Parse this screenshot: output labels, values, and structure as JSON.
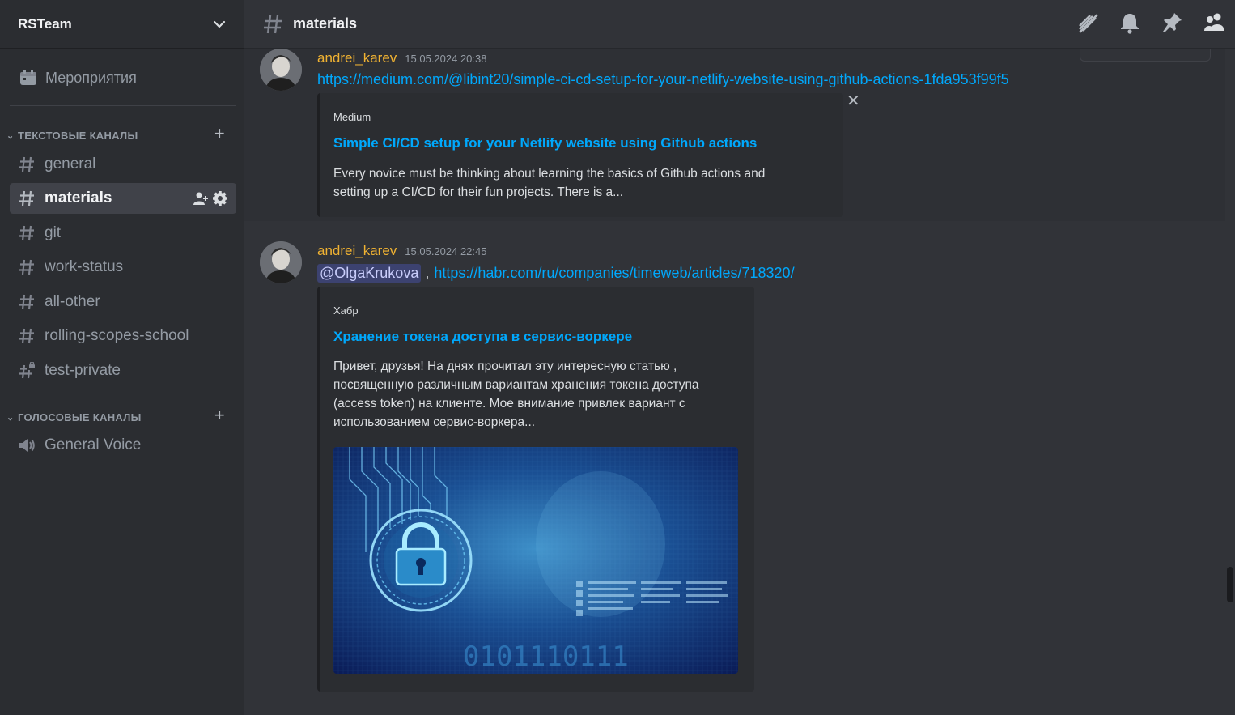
{
  "server": {
    "name": "RSTeam"
  },
  "sidebar": {
    "events_label": "Мероприятия",
    "text_category": "ТЕКСТОВЫЕ КАНАЛЫ",
    "voice_category": "ГОЛОСОВЫЕ КАНАЛЫ",
    "text_channels": [
      {
        "name": "general"
      },
      {
        "name": "materials",
        "active": true
      },
      {
        "name": "git"
      },
      {
        "name": "work-status"
      },
      {
        "name": "all-other"
      },
      {
        "name": "rolling-scopes-school"
      },
      {
        "name": "test-private"
      }
    ],
    "voice_channels": [
      {
        "name": "General Voice"
      }
    ]
  },
  "header": {
    "channel": "materials",
    "icons": [
      "threads-icon",
      "bell-icon",
      "pin-icon",
      "members-icon"
    ]
  },
  "messages": [
    {
      "author": "andrei_karev",
      "timestamp": "15.05.2024 20:38",
      "link": "https://medium.com/@libint20/simple-ci-cd-setup-for-your-netlify-website-using-github-actions-1fda953f99f5",
      "embed": {
        "provider": "Medium",
        "title": "Simple CI/CD setup for your Netlify website using Github actions",
        "description_lines": [
          "Every novice must be thinking about learning the basics of Github actions and",
          "setting up a CI/CD for their fun projects. There is a..."
        ]
      }
    },
    {
      "author": "andrei_karev",
      "timestamp": "15.05.2024 22:45",
      "mention": "@OlgaKrukova",
      "separator": " ,",
      "link": "https://habr.com/ru/companies/timeweb/articles/718320/",
      "embed": {
        "provider": "Хабр",
        "title": "Хранение токена доступа в сервис-воркере",
        "description_lines": [
          "Привет, друзья! На днях прочитал эту интересную статью ,",
          "посвященную различным вариантам хранения токена доступа",
          "(access token) на клиенте. Мое внимание привлек вариант с",
          "использованием сервис-воркера..."
        ],
        "image_binary": "0101110111"
      }
    }
  ],
  "colors": {
    "accent_link": "#00a8fc",
    "author": "#f0b232",
    "sidebar_bg": "#2b2d31",
    "chat_bg": "#313338"
  }
}
